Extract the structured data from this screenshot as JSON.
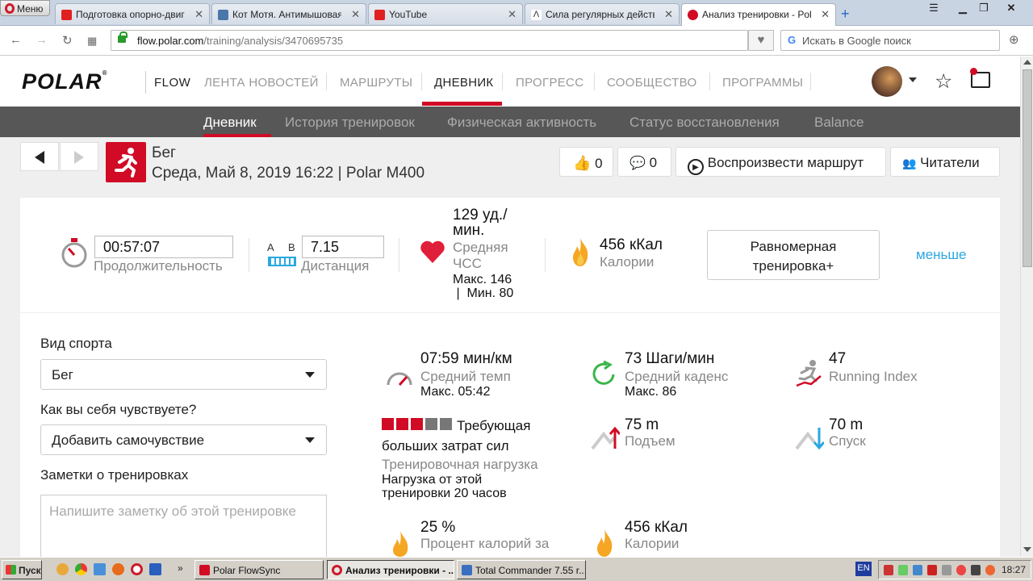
{
  "browser": {
    "menu_label": "Меню",
    "tabs": [
      {
        "label": "Подготовка опорно-двигат",
        "color": "#e02020"
      },
      {
        "label": "Кот Мотя. Антимышовая ко",
        "color": "#4a76a8"
      },
      {
        "label": "YouTube",
        "color": "#e02020"
      },
      {
        "label": "Сила регулярных действий",
        "color": "#333333"
      },
      {
        "label": "Анализ тренировки - Polar F",
        "color": "#d10b25"
      }
    ],
    "url_host": "flow.polar.com",
    "url_path": "/training/analysis/3470695735",
    "search_placeholder": "Искать в Google поиск",
    "search_g": "G"
  },
  "header": {
    "logo": "POLAR",
    "logo_reg": "®",
    "flow": "FLOW",
    "nav": [
      "ЛЕНТА НОВОСТЕЙ",
      "МАРШРУТЫ",
      "ДНЕВНИК",
      "ПРОГРЕСС",
      "СООБЩЕСТВО",
      "ПРОГРАММЫ"
    ],
    "active_nav": "ДНЕВНИК"
  },
  "subnav": {
    "items": [
      "Дневник",
      "История тренировок",
      "Физическая активность",
      "Статус восстановления",
      "Balance"
    ],
    "active": "Дневник"
  },
  "training": {
    "sport": "Бег",
    "datetime": "Среда, Май 8, 2019 16:22 | Polar M400",
    "likes": "0",
    "comments": "0",
    "replay_label": "Воспроизвести маршрут",
    "followers_label": "Читатели"
  },
  "summary": {
    "duration_value": "00:57:07",
    "duration_label": "Продолжительность",
    "ab_a": "A",
    "ab_b": "B",
    "distance_value": "7.15",
    "distance_label": "Дистанция",
    "hr_value_line1": "129 уд./",
    "hr_value_line2": "мин.",
    "hr_label_line1": "Средняя",
    "hr_label_line2": "ЧСС",
    "hr_max": "Макс. 146",
    "hr_min": " |  Мин. 80",
    "calories_value": "456 кКал",
    "calories_label": "Калории",
    "benefit_line1": "Равномерная",
    "benefit_line2": "тренировка+",
    "less_label": "меньше"
  },
  "form": {
    "sport_label": "Вид спорта",
    "sport_value": "Бег",
    "feeling_label": "Как вы себя чувствуете?",
    "feeling_value": "Добавить самочувствие",
    "notes_label": "Заметки о тренировках",
    "notes_placeholder": "Напишите заметку об этой тренировке"
  },
  "stats": {
    "pace_value": "07:59 мин/км",
    "pace_label": "Средний темп",
    "pace_max": "Макс. 05:42",
    "cadence_value": "73 Шаги/мин",
    "cadence_label": "Средний каденс",
    "cadence_max": "Макс. 86",
    "ri_value": "47",
    "ri_label": "Running Index",
    "load_title_line1": "Требующая",
    "load_title_line2": "больших затрат сил",
    "load_label": "Тренировочная нагрузка",
    "load_note_line1": "Нагрузка от этой",
    "load_note_line2": "тренировки 20 часов",
    "load_blocks_filled": 3,
    "load_blocks_total": 5,
    "ascent_value": "75 m",
    "ascent_label": "Подъем",
    "descent_value": "70 m",
    "descent_label": "Спуск",
    "fat_value": "25 %",
    "fat_label": "Процент калорий за",
    "cal2_value": "456 кКал",
    "cal2_label": "Калории"
  },
  "taskbar": {
    "start": "Пуск",
    "windows": [
      "Polar FlowSync",
      "Анализ тренировки - ...",
      "Total Commander 7.55 r..."
    ],
    "lang": "EN",
    "clock": "18:27"
  }
}
